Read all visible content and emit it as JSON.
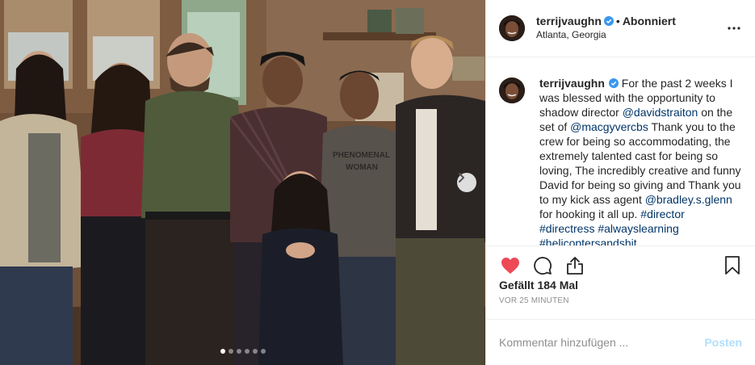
{
  "post": {
    "account": {
      "username": "terrijvaughn",
      "follow_separator": "•",
      "follow_status": "Abonniert",
      "location": "Atlanta, Georgia",
      "verified": true
    },
    "caption": {
      "username": "terrijvaughn",
      "segments": [
        {
          "type": "text",
          "value": " For the past 2 weeks I was blessed with the opportunity to shadow director "
        },
        {
          "type": "mention",
          "value": "@davidstraiton"
        },
        {
          "type": "text",
          "value": " on the set of "
        },
        {
          "type": "mention",
          "value": "@macgyvercbs"
        },
        {
          "type": "text",
          "value": " Thank you to the crew for being so accommodating, the extremely talented cast for being so loving, The incredibly creative and funny David for being so giving and Thank you to my kick ass agent "
        },
        {
          "type": "mention",
          "value": "@bradley.s.glenn"
        },
        {
          "type": "text",
          "value": " for hooking it all up. "
        },
        {
          "type": "mention",
          "value": "#director"
        },
        {
          "type": "text",
          "value": " "
        },
        {
          "type": "mention",
          "value": "#directress"
        },
        {
          "type": "text",
          "value": " "
        },
        {
          "type": "mention",
          "value": "#alwayslearning"
        },
        {
          "type": "text",
          "value": " "
        },
        {
          "type": "mention",
          "value": "#helicoptersandshit"
        }
      ]
    },
    "likes": "Gefällt 184 Mal",
    "time_ago": "VOR 25 MINUTEN",
    "comment_placeholder": "Kommentar hinzufügen ...",
    "post_button": "Posten",
    "carousel": {
      "slide_count": 6,
      "active_index": 0
    },
    "shirt_text": "PHENOMENAL WOMAN",
    "icons": [
      "verified-badge-icon",
      "more-options-icon",
      "heart-icon",
      "comment-icon",
      "share-icon",
      "bookmark-icon",
      "chevron-right-icon"
    ],
    "colors": {
      "heart": "#ed4956",
      "mention": "#003569",
      "verified": "#3897f0",
      "post_button": "#b2dffc",
      "muted": "#8e8e8e"
    }
  }
}
